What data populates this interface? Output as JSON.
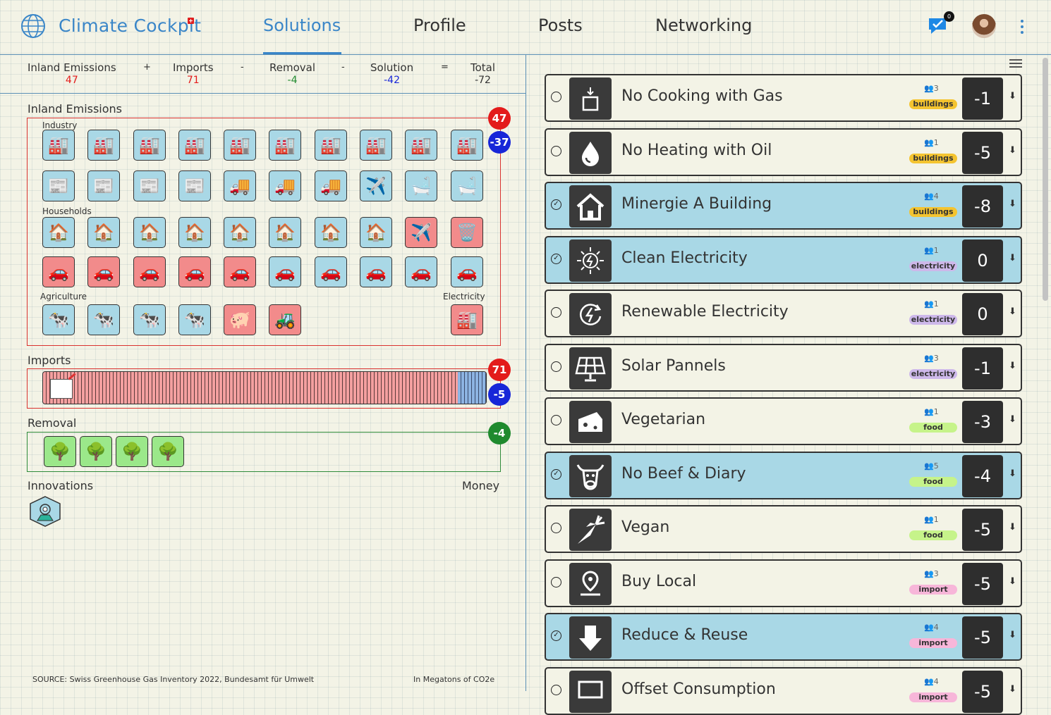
{
  "header": {
    "brand": "Climate Cockpit",
    "nav": [
      "Solutions",
      "Profile",
      "Posts",
      "Networking"
    ],
    "notification_count": "0"
  },
  "formula": {
    "inland": {
      "label": "Inland Emissions",
      "value": "47",
      "color": "#e31b1b"
    },
    "plus": "+",
    "imports": {
      "label": "Imports",
      "value": "71",
      "color": "#e31b1b"
    },
    "minus1": "-",
    "removal": {
      "label": "Removal",
      "value": "-4",
      "color": "#1f8a2e"
    },
    "minus2": "-",
    "solution": {
      "label": "Solution",
      "value": "-42",
      "color": "#1726d8"
    },
    "equals": "=",
    "total": {
      "label": "Total",
      "value": "-72",
      "color": "#333333"
    }
  },
  "inland": {
    "title": "Inland Emissions",
    "badge_total": "47",
    "badge_solution": "-37",
    "groups": {
      "industry": "Industry",
      "households": "Households",
      "agriculture": "Agriculture",
      "electricity": "Electricity"
    }
  },
  "imports": {
    "title": "Imports",
    "badge_total": "71",
    "badge_solution": "-5"
  },
  "removal": {
    "title": "Removal",
    "badge": "-4"
  },
  "innovations": {
    "title": "Innovations",
    "money": "Money"
  },
  "footer": {
    "source": "SOURCE: Swiss Greenhouse Gas Inventory 2022, Bundesamt für Umwelt",
    "unit": "In Megatons of CO2e"
  },
  "tiles": [
    {
      "row": 0,
      "icon": "🏭",
      "color": "b",
      "n": 10
    },
    {
      "row": 1,
      "icons": [
        "📰",
        "📰",
        "📰",
        "📰",
        "🚚",
        "🚚",
        "🚚",
        "✈️",
        "🛁",
        "🛁"
      ],
      "colors": [
        "b",
        "b",
        "b",
        "b",
        "b",
        "b",
        "b",
        "b",
        "b",
        "b"
      ]
    },
    {
      "row": 2,
      "icons": [
        "🏠",
        "🏠",
        "🏠",
        "🏠",
        "🏠",
        "🏠",
        "🏠",
        "🏠",
        "✈️",
        "🗑️"
      ],
      "colors": [
        "b",
        "b",
        "b",
        "b",
        "b",
        "b",
        "b",
        "b",
        "r",
        "r"
      ]
    },
    {
      "row": 3,
      "icons": [
        "🚗",
        "🚗",
        "🚗",
        "🚗",
        "🚗",
        "🚗",
        "🚗",
        "🚗",
        "🚗",
        "🚗"
      ],
      "colors": [
        "r",
        "r",
        "r",
        "r",
        "r",
        "b",
        "b",
        "b",
        "b",
        "b"
      ]
    },
    {
      "row": 4,
      "icons": [
        "🐄",
        "🐄",
        "🐄",
        "🐄",
        "🐖",
        "🚜"
      ],
      "colors": [
        "b",
        "b",
        "b",
        "b",
        "r",
        "r"
      ]
    }
  ],
  "electricity_tile": {
    "icon": "🏭",
    "color": "r"
  },
  "trees": [
    "🌳",
    "🌳",
    "🌳",
    "🌳"
  ],
  "solutions": [
    {
      "title": "No Cooking with Gas",
      "people": "3",
      "tag": "buildings",
      "value": "-1",
      "selected": false,
      "icon": "stove-icon"
    },
    {
      "title": "No Heating with Oil",
      "people": "1",
      "tag": "buildings",
      "value": "-5",
      "selected": false,
      "icon": "oil-drop-icon"
    },
    {
      "title": "Minergie A Building",
      "people": "4",
      "tag": "buildings",
      "value": "-8",
      "selected": true,
      "icon": "house-icon"
    },
    {
      "title": "Clean Electricity",
      "people": "1",
      "tag": "electricity",
      "value": "0",
      "selected": true,
      "icon": "bolt-sun-icon"
    },
    {
      "title": "Renewable Electricity",
      "people": "1",
      "tag": "electricity",
      "value": "0",
      "selected": false,
      "icon": "renew-bolt-icon"
    },
    {
      "title": "Solar Pannels",
      "people": "3",
      "tag": "electricity",
      "value": "-1",
      "selected": false,
      "icon": "solar-panel-icon"
    },
    {
      "title": "Vegetarian",
      "people": "1",
      "tag": "food",
      "value": "-3",
      "selected": false,
      "icon": "cheese-icon"
    },
    {
      "title": "No Beef & Diary",
      "people": "5",
      "tag": "food",
      "value": "-4",
      "selected": true,
      "icon": "cow-icon"
    },
    {
      "title": "Vegan",
      "people": "1",
      "tag": "food",
      "value": "-5",
      "selected": false,
      "icon": "carrot-icon"
    },
    {
      "title": "Buy Local",
      "people": "3",
      "tag": "import",
      "value": "-5",
      "selected": false,
      "icon": "location-pin-icon"
    },
    {
      "title": "Reduce & Reuse",
      "people": "4",
      "tag": "import",
      "value": "-5",
      "selected": true,
      "icon": "down-arrow-icon"
    },
    {
      "title": "Offset Consumption",
      "people": "4",
      "tag": "import",
      "value": "-5",
      "selected": false,
      "icon": "screen-icon"
    }
  ]
}
